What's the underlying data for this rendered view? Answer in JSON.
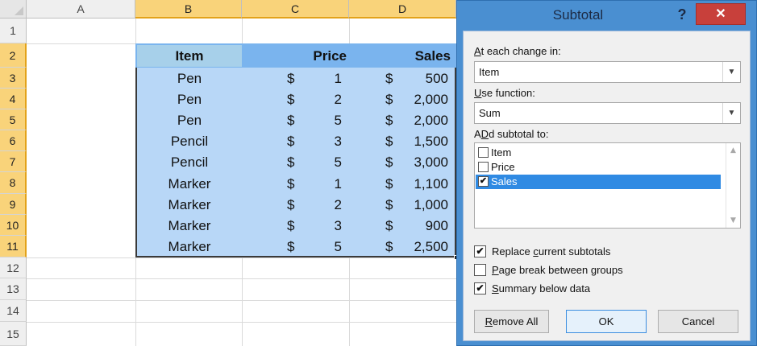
{
  "sheet": {
    "columns": [
      "A",
      "B",
      "C",
      "D"
    ],
    "rows": [
      "1",
      "2",
      "3",
      "4",
      "5",
      "6",
      "7",
      "8",
      "9",
      "10",
      "11",
      "12",
      "13",
      "14",
      "15"
    ],
    "headers": {
      "item": "Item",
      "price": "Price",
      "sales": "Sales"
    },
    "currency": "$",
    "data": [
      {
        "item": "Pen",
        "price": "1",
        "sales": "500"
      },
      {
        "item": "Pen",
        "price": "2",
        "sales": "2,000"
      },
      {
        "item": "Pen",
        "price": "5",
        "sales": "2,000"
      },
      {
        "item": "Pencil",
        "price": "3",
        "sales": "1,500"
      },
      {
        "item": "Pencil",
        "price": "5",
        "sales": "3,000"
      },
      {
        "item": "Marker",
        "price": "1",
        "sales": "1,100"
      },
      {
        "item": "Marker",
        "price": "2",
        "sales": "1,000"
      },
      {
        "item": "Marker",
        "price": "3",
        "sales": "900"
      },
      {
        "item": "Marker",
        "price": "5",
        "sales": "2,500"
      }
    ]
  },
  "dialog": {
    "title": "Subtotal",
    "help": "?",
    "close": "✕",
    "at_each_change": {
      "mnemonic": "A",
      "rest": "t each change in:",
      "value": "Item"
    },
    "use_function": {
      "mnemonic": "U",
      "rest": "se function:",
      "value": "Sum"
    },
    "add_subtotal": {
      "mnemonic": "D",
      "prefix": "A",
      "rest": "d subtotal to:"
    },
    "list_items": [
      {
        "label": "Item",
        "checked": false
      },
      {
        "label": "Price",
        "checked": false
      },
      {
        "label": "Sales",
        "checked": true
      }
    ],
    "options": {
      "replace": {
        "prefix": "Replace ",
        "mnemonic": "c",
        "rest": "urrent subtotals",
        "checked": true
      },
      "page_break": {
        "prefix": "",
        "mnemonic": "P",
        "rest": "age break between groups",
        "checked": false
      },
      "summary": {
        "prefix": "",
        "mnemonic": "S",
        "rest": "ummary below data",
        "checked": true
      }
    },
    "buttons": {
      "remove_all": {
        "mnemonic": "R",
        "rest": "emove All"
      },
      "ok": "OK",
      "cancel": "Cancel"
    },
    "colors": {
      "accent": "#4a8fd1",
      "close": "#c8403b",
      "selection": "#2f8ae3",
      "table_fill": "#b8d7f7"
    }
  }
}
